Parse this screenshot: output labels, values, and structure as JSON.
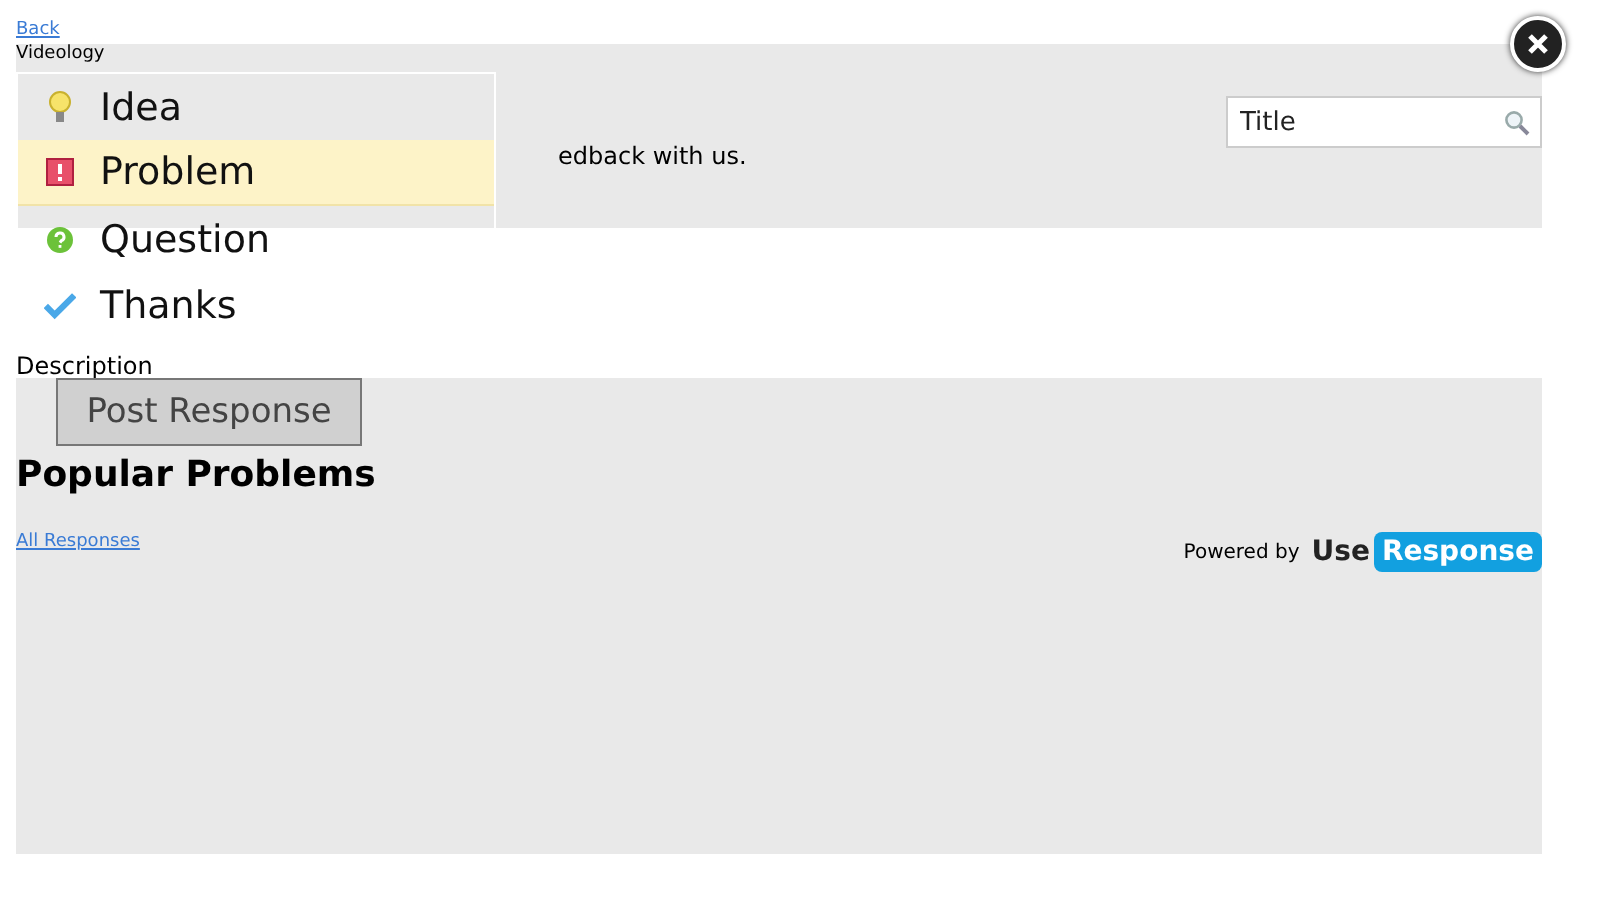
{
  "back_link": "Back",
  "brand": "Videology",
  "intro": "edback with us.",
  "search": {
    "value": "Title"
  },
  "description_label": "Description",
  "type_menu": [
    {
      "label": "Idea",
      "kind": "idea",
      "selected": false
    },
    {
      "label": "Problem",
      "kind": "problem",
      "selected": true
    },
    {
      "label": "Question",
      "kind": "question",
      "selected": false
    },
    {
      "label": "Thanks",
      "kind": "thanks",
      "selected": false
    }
  ],
  "post_button": "Post Response",
  "heading": "Popular Problems",
  "all_responses_link": "All Responses",
  "powered_by": {
    "text": "Powered by",
    "logo_left": "Use",
    "logo_right": "Response"
  }
}
